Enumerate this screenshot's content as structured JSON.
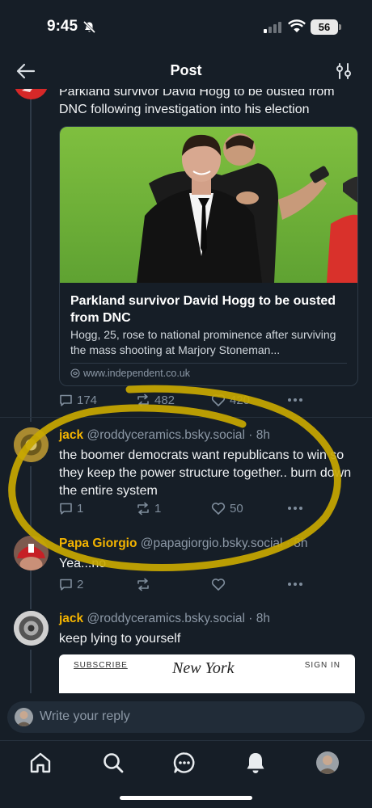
{
  "status_bar": {
    "time": "9:45",
    "battery": "56"
  },
  "header": {
    "title": "Post",
    "back_icon": "arrow-left-icon",
    "filter_icon": "sliders-icon"
  },
  "parent_post": {
    "text": "Parkland survivor David Hogg to be ousted from DNC following investigation into his election",
    "card": {
      "title": "Parkland survivor David Hogg to be ousted from DNC",
      "description": "Hogg, 25, rose to national prominence after surviving the mass shooting at Marjory Stoneman...",
      "domain": "www.independent.co.uk"
    },
    "replies": "174",
    "reposts": "482",
    "likes": "420"
  },
  "replies": [
    {
      "name": "jack",
      "handle": "@roddyceramics.bsky.social",
      "time": "· 8h",
      "text": "the boomer democrats want republicans to win so they keep the power structure together.. burn down the entire system",
      "replies": "1",
      "reposts": "1",
      "likes": "50"
    },
    {
      "name": "Papa Giorgio",
      "handle": "@papagiorgio.bsky.social",
      "time": "· 8h",
      "text": "Yea...no",
      "replies": "2",
      "reposts": "",
      "likes": ""
    },
    {
      "name": "jack",
      "handle": "@roddyceramics.bsky.social",
      "time": "· 8h",
      "text": "keep lying to yourself",
      "embed": {
        "subscribe": "SUBSCRIBE",
        "logo": "New York",
        "sign_in": "SIGN IN"
      }
    }
  ],
  "reply_bar": {
    "placeholder": "Write your reply"
  },
  "nav": [
    "home-icon",
    "search-icon",
    "chat-icon",
    "bell-icon",
    "profile-avatar"
  ],
  "colors": {
    "background": "#161e27",
    "accent_name": "#f4b400",
    "muted": "#8c98a6",
    "annotation": "#c9a800"
  }
}
